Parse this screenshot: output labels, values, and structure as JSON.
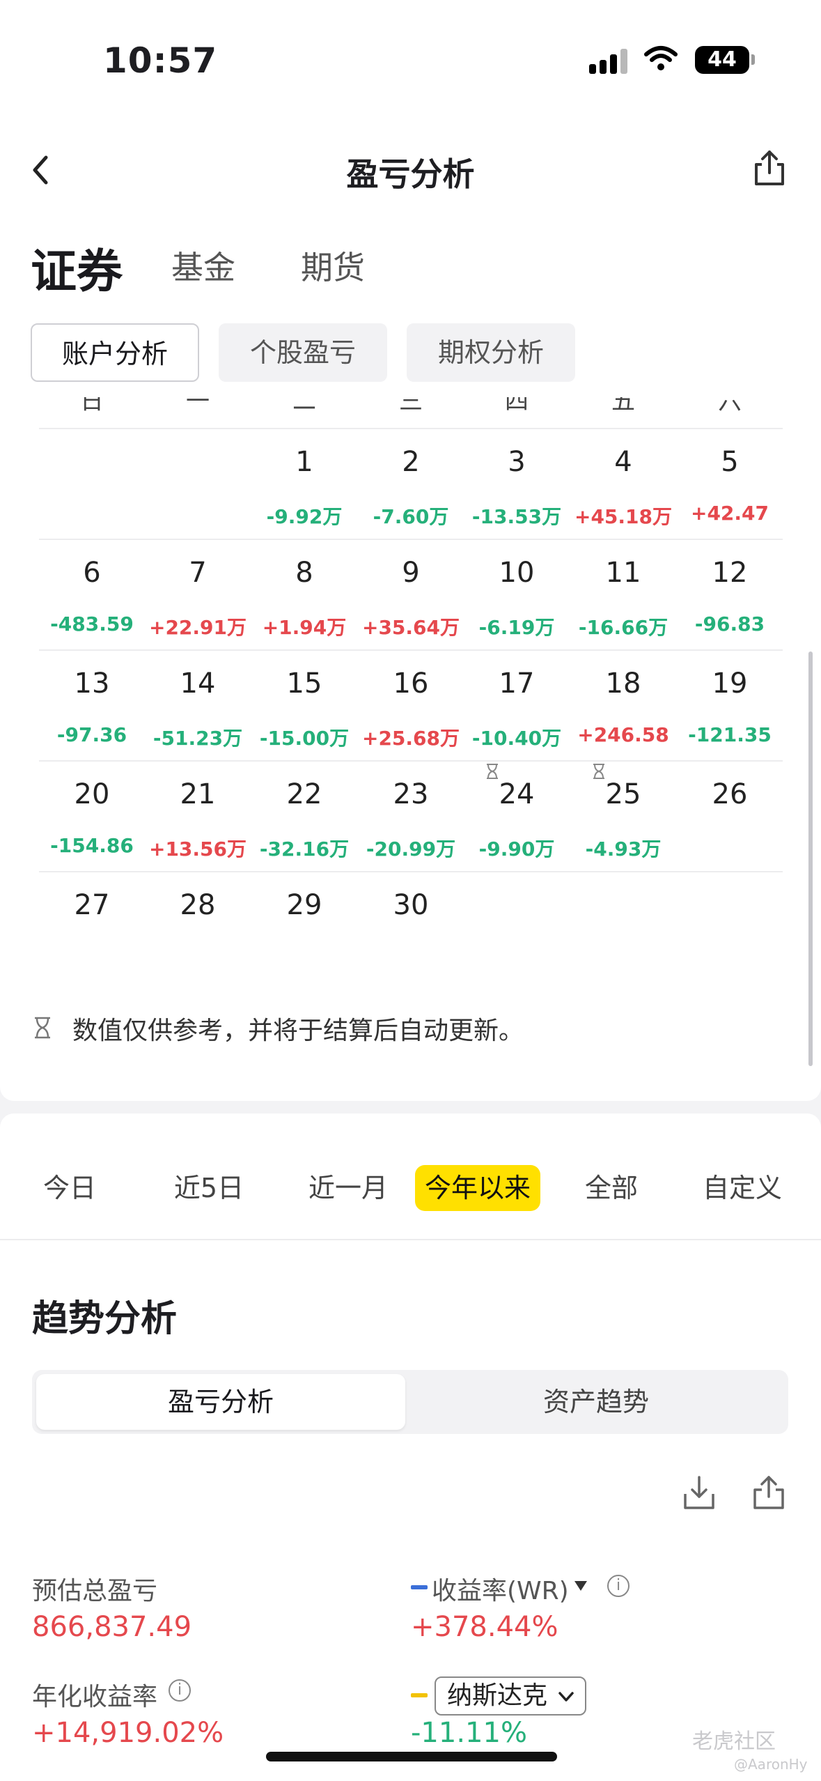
{
  "status_bar": {
    "time": "10:57",
    "battery": "44"
  },
  "header": {
    "title": "盈亏分析"
  },
  "category_tabs": [
    "证券",
    "基金",
    "期货"
  ],
  "sub_tabs": [
    "账户分析",
    "个股盈亏",
    "期权分析"
  ],
  "calendar": {
    "weekdays": [
      "日",
      "一",
      "二",
      "三",
      "四",
      "五",
      "六"
    ],
    "weeks": [
      [
        {
          "day": "",
          "pl": ""
        },
        {
          "day": "",
          "pl": ""
        },
        {
          "day": "1",
          "pl": "-9.92万"
        },
        {
          "day": "2",
          "pl": "-7.60万"
        },
        {
          "day": "3",
          "pl": "-13.53万"
        },
        {
          "day": "4",
          "pl": "+45.18万"
        },
        {
          "day": "5",
          "pl": "+42.47"
        }
      ],
      [
        {
          "day": "6",
          "pl": "-483.59"
        },
        {
          "day": "7",
          "pl": "+22.91万"
        },
        {
          "day": "8",
          "pl": "+1.94万"
        },
        {
          "day": "9",
          "pl": "+35.64万"
        },
        {
          "day": "10",
          "pl": "-6.19万"
        },
        {
          "day": "11",
          "pl": "-16.66万"
        },
        {
          "day": "12",
          "pl": "-96.83"
        }
      ],
      [
        {
          "day": "13",
          "pl": "-97.36"
        },
        {
          "day": "14",
          "pl": "-51.23万"
        },
        {
          "day": "15",
          "pl": "-15.00万"
        },
        {
          "day": "16",
          "pl": "+25.68万"
        },
        {
          "day": "17",
          "pl": "-10.40万"
        },
        {
          "day": "18",
          "pl": "+246.58"
        },
        {
          "day": "19",
          "pl": "-121.35"
        }
      ],
      [
        {
          "day": "20",
          "pl": "-154.86"
        },
        {
          "day": "21",
          "pl": "+13.56万"
        },
        {
          "day": "22",
          "pl": "-32.16万"
        },
        {
          "day": "23",
          "pl": "-20.99万"
        },
        {
          "day": "24",
          "pl": "-9.90万"
        },
        {
          "day": "25",
          "pl": "-4.93万"
        },
        {
          "day": "26",
          "pl": ""
        }
      ],
      [
        {
          "day": "27",
          "pl": ""
        },
        {
          "day": "28",
          "pl": ""
        },
        {
          "day": "29",
          "pl": ""
        },
        {
          "day": "30",
          "pl": ""
        },
        {
          "day": "",
          "pl": ""
        },
        {
          "day": "",
          "pl": ""
        },
        {
          "day": "",
          "pl": ""
        }
      ]
    ],
    "pending_days": [
      "24",
      "25"
    ],
    "note": "数值仅供参考，并将于结算后自动更新。"
  },
  "period_tabs": {
    "items": [
      "今日",
      "近5日",
      "近一月",
      "今年以来",
      "全部",
      "自定义"
    ],
    "selected": "今年以来"
  },
  "trend": {
    "title": "趋势分析",
    "segments": [
      "盈亏分析",
      "资产趋势"
    ],
    "selected_segment": "盈亏分析",
    "metrics": {
      "total_pl_label": "预估总盈亏",
      "total_pl_value": "866,837.49",
      "return_label": "收益率(WR)",
      "return_value": "+378.44%",
      "annual_label": "年化收益率",
      "annual_value": "+14,919.02%",
      "benchmark_label": "纳斯达克",
      "benchmark_value": "-11.11%"
    }
  },
  "watermark": {
    "brand": "老虎社区",
    "handle": "@AaronHy"
  },
  "colors": {
    "up": "#e5484d",
    "down": "#25b07a",
    "accent": "#ffe000",
    "wr_legend": "#3b6fd8",
    "benchmark_legend": "#f2c200"
  }
}
